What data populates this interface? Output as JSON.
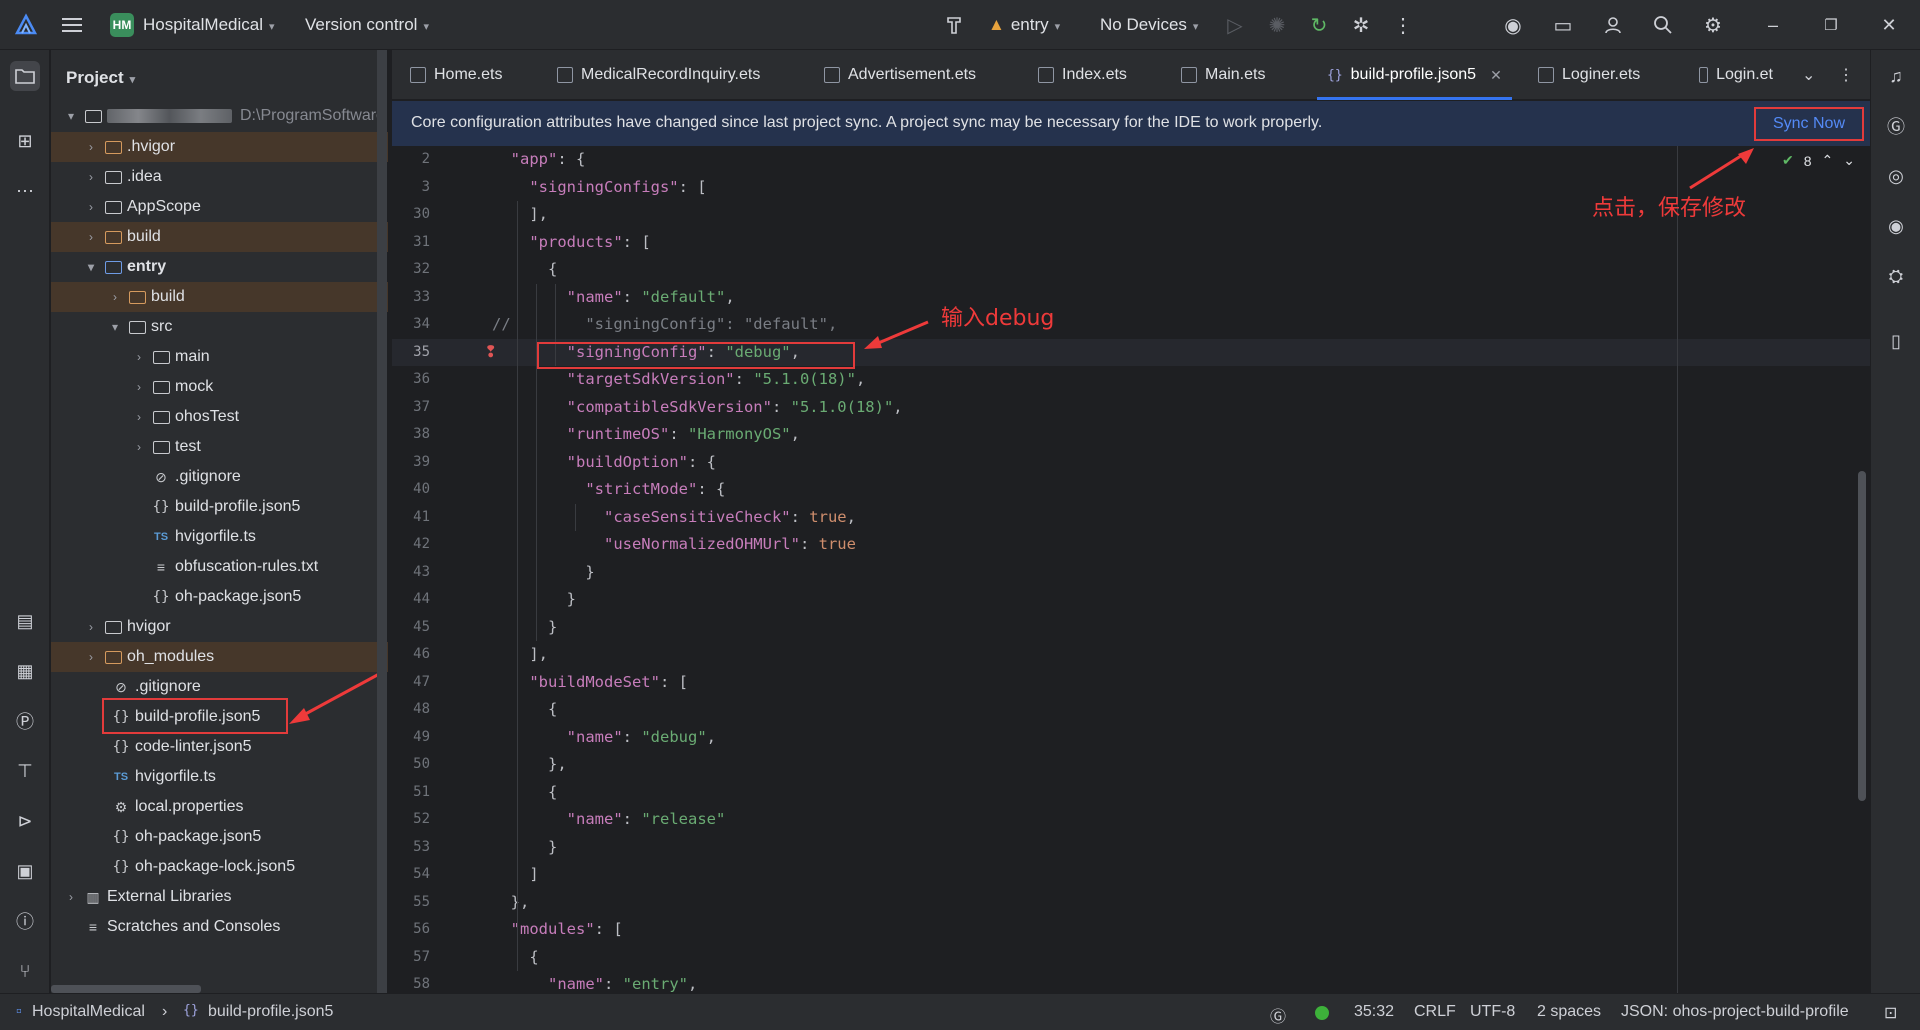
{
  "titlebar": {
    "project_badge": "HM",
    "project_name": "HospitalMedical",
    "version_control": "Version control",
    "run_config": "entry",
    "device": "No Devices"
  },
  "project_panel": {
    "title": "Project",
    "root_path": "D:\\ProgramSoftware",
    "items": [
      {
        "label": ".hvigor",
        "type": "folder-excluded"
      },
      {
        "label": ".idea",
        "type": "folder"
      },
      {
        "label": "AppScope",
        "type": "folder"
      },
      {
        "label": "build",
        "type": "folder-excluded"
      },
      {
        "label": "entry",
        "type": "module"
      },
      {
        "label": "build",
        "type": "folder-excluded"
      },
      {
        "label": "src",
        "type": "folder"
      },
      {
        "label": "main",
        "type": "folder"
      },
      {
        "label": "mock",
        "type": "folder"
      },
      {
        "label": "ohosTest",
        "type": "folder"
      },
      {
        "label": "test",
        "type": "folder"
      },
      {
        "label": ".gitignore",
        "type": "ignore"
      },
      {
        "label": "build-profile.json5",
        "type": "json"
      },
      {
        "label": "hvigorfile.ts",
        "type": "ts"
      },
      {
        "label": "obfuscation-rules.txt",
        "type": "text"
      },
      {
        "label": "oh-package.json5",
        "type": "json"
      },
      {
        "label": "hvigor",
        "type": "folder"
      },
      {
        "label": "oh_modules",
        "type": "folder-excluded"
      },
      {
        "label": ".gitignore",
        "type": "ignore"
      },
      {
        "label": "build-profile.json5",
        "type": "json"
      },
      {
        "label": "code-linter.json5",
        "type": "json"
      },
      {
        "label": "hvigorfile.ts",
        "type": "ts"
      },
      {
        "label": "local.properties",
        "type": "settings"
      },
      {
        "label": "oh-package.json5",
        "type": "json"
      },
      {
        "label": "oh-package-lock.json5",
        "type": "json"
      },
      {
        "label": "External Libraries",
        "type": "library"
      },
      {
        "label": "Scratches and Consoles",
        "type": "scratch"
      }
    ]
  },
  "tabs": [
    {
      "label": "Home.ets"
    },
    {
      "label": "MedicalRecordInquiry.ets"
    },
    {
      "label": "Advertisement.ets"
    },
    {
      "label": "Index.ets"
    },
    {
      "label": "Main.ets"
    },
    {
      "label": "build-profile.json5",
      "active": true
    },
    {
      "label": "Loginer.ets"
    },
    {
      "label": "Login.et"
    }
  ],
  "banner": {
    "message": "Core configuration attributes have changed since last project sync. A project sync may be necessary for the IDE to work properly.",
    "action": "Sync Now"
  },
  "editor": {
    "inspection_count": "8",
    "lines": [
      {
        "n": "2",
        "code": "  \"app\": {"
      },
      {
        "n": "3",
        "code": "    \"signingConfigs\": ["
      },
      {
        "n": "30",
        "code": "    ],"
      },
      {
        "n": "31",
        "code": "    \"products\": ["
      },
      {
        "n": "32",
        "code": "      {"
      },
      {
        "n": "33",
        "code": "        \"name\": \"default\","
      },
      {
        "n": "34",
        "code": "//        \"signingConfig\": \"default\","
      },
      {
        "n": "35",
        "code": "        \"signingConfig\": \"debug\","
      },
      {
        "n": "36",
        "code": "        \"targetSdkVersion\": \"5.1.0(18)\","
      },
      {
        "n": "37",
        "code": "        \"compatibleSdkVersion\": \"5.1.0(18)\","
      },
      {
        "n": "38",
        "code": "        \"runtimeOS\": \"HarmonyOS\","
      },
      {
        "n": "39",
        "code": "        \"buildOption\": {"
      },
      {
        "n": "40",
        "code": "          \"strictMode\": {"
      },
      {
        "n": "41",
        "code": "            \"caseSensitiveCheck\": true,"
      },
      {
        "n": "42",
        "code": "            \"useNormalizedOHMUrl\": true"
      },
      {
        "n": "43",
        "code": "          }"
      },
      {
        "n": "44",
        "code": "        }"
      },
      {
        "n": "45",
        "code": "      }"
      },
      {
        "n": "46",
        "code": "    ],"
      },
      {
        "n": "47",
        "code": "    \"buildModeSet\": ["
      },
      {
        "n": "48",
        "code": "      {"
      },
      {
        "n": "49",
        "code": "        \"name\": \"debug\","
      },
      {
        "n": "50",
        "code": "      },"
      },
      {
        "n": "51",
        "code": "      {"
      },
      {
        "n": "52",
        "code": "        \"name\": \"release\""
      },
      {
        "n": "53",
        "code": "      }"
      },
      {
        "n": "54",
        "code": "    ]"
      },
      {
        "n": "55",
        "code": "  },"
      },
      {
        "n": "56",
        "code": "  \"modules\": ["
      },
      {
        "n": "57",
        "code": "    {"
      },
      {
        "n": "58",
        "code": "      \"name\": \"entry\","
      }
    ]
  },
  "annotations": {
    "sync_note": "点击，保存修改",
    "debug_note": "输入debug"
  },
  "status_bar": {
    "project": "HospitalMedical",
    "file": "build-profile.json5",
    "position": "35:32",
    "line_ending": "CRLF",
    "encoding": "UTF-8",
    "indent": "2 spaces",
    "schema": "JSON: ohos-project-build-profile"
  },
  "colors": {
    "accent": "#3574f0",
    "annotation_red": "#e23b3b",
    "banner_bg": "#25324d"
  }
}
